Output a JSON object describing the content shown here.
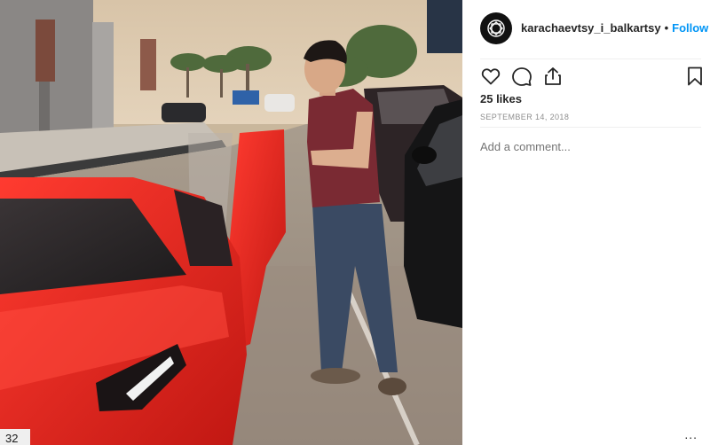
{
  "post": {
    "username": "karachaevtsy_i_balkartsy",
    "separator": "•",
    "follow_label": "Follow",
    "likes_text": "25 likes",
    "date": "SEPTEMBER 14, 2018",
    "comment_placeholder": "Add a comment...",
    "more_label": "...",
    "plate_text": "32"
  },
  "icons": {
    "like": "heart-icon",
    "comment": "comment-icon",
    "share": "share-icon",
    "save": "bookmark-icon",
    "avatar": "brand-logo-icon"
  },
  "colors": {
    "accent": "#0095f6",
    "text": "#262626",
    "muted": "#8e8e8e",
    "car": "#e8231f"
  }
}
